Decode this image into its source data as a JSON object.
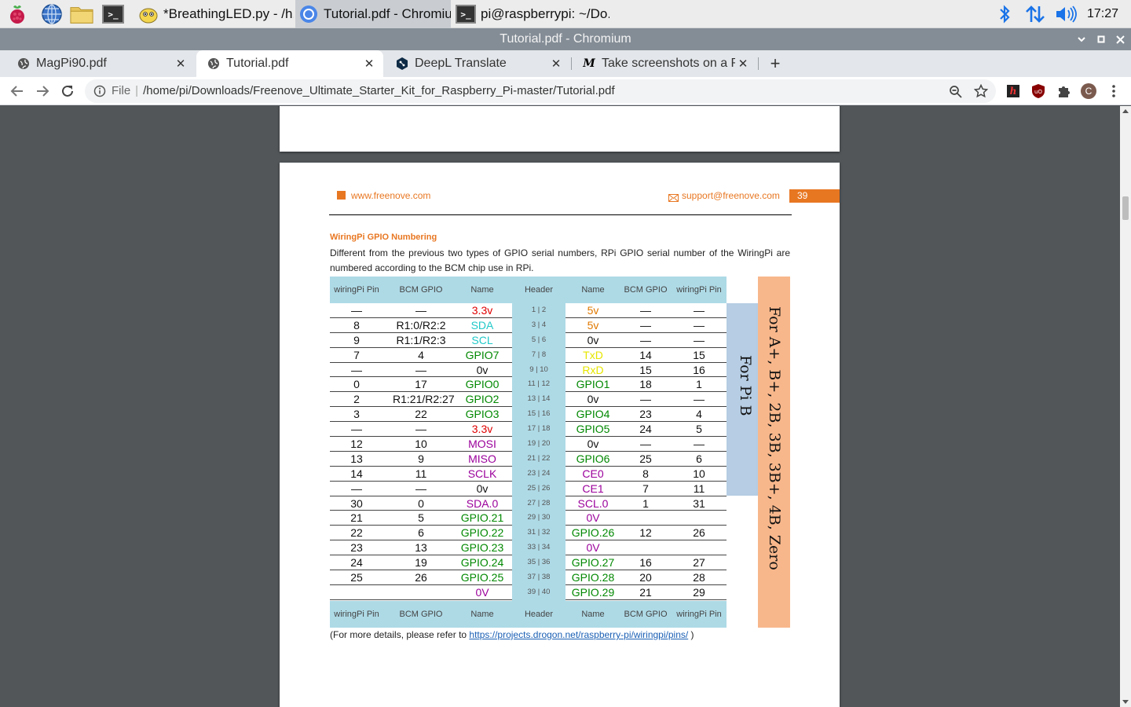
{
  "taskbar": {
    "tasks": [
      {
        "label": "*BreathingLED.py - /h...",
        "icon": "python-icon"
      },
      {
        "label": "Tutorial.pdf - Chromiu...",
        "icon": "chromium-icon"
      },
      {
        "label": "pi@raspberrypi: ~/Do...",
        "icon": "terminal-icon"
      }
    ],
    "clock": "17:27"
  },
  "window": {
    "title": "Tutorial.pdf - Chromium"
  },
  "tabs": [
    {
      "label": "MagPi90.pdf",
      "icon": "globe-icon"
    },
    {
      "label": "Tutorial.pdf",
      "icon": "globe-icon"
    },
    {
      "label": "DeepL Translate",
      "icon": "deepl-icon"
    },
    {
      "label": "Take screenshots on a R",
      "icon": "medium-icon"
    }
  ],
  "toolbar": {
    "scheme": "File",
    "url": "/home/pi/Downloads/Freenove_Ultimate_Starter_Kit_for_Raspberry_Pi-master/Tutorial.pdf",
    "avatar_letter": "C"
  },
  "pdf": {
    "header": {
      "left": "www.freenove.com",
      "right": "support@freenove.com",
      "page_number": "39"
    },
    "section_title": "WiringPi GPIO Numbering",
    "paragraph": "Different from the previous two types of GPIO serial numbers, RPi GPIO serial number of the WiringPi are numbered according to the BCM chip use in RPi.",
    "ref_prefix": "(For more details, please refer to ",
    "ref_link": "https://projects.drogon.net/raspberry-pi/wiringpi/pins/",
    "ref_suffix": " )",
    "table": {
      "head": [
        "wiringPi Pin",
        "BCM GPIO",
        "Name",
        "Header",
        "Name",
        "BCM GPIO",
        "wiringPi Pin"
      ],
      "rows": [
        [
          "—",
          "—",
          "3.3v",
          "1 | 2",
          "5v",
          "—",
          "—"
        ],
        [
          "8",
          "R1:0/R2:2",
          "SDA",
          "3 | 4",
          "5v",
          "—",
          "—"
        ],
        [
          "9",
          "R1:1/R2:3",
          "SCL",
          "5 | 6",
          "0v",
          "—",
          "—"
        ],
        [
          "7",
          "4",
          "GPIO7",
          "7 | 8",
          "TxD",
          "14",
          "15"
        ],
        [
          "—",
          "—",
          "0v",
          "9 | 10",
          "RxD",
          "15",
          "16"
        ],
        [
          "0",
          "17",
          "GPIO0",
          "11 | 12",
          "GPIO1",
          "18",
          "1"
        ],
        [
          "2",
          "R1:21/R2:27",
          "GPIO2",
          "13 | 14",
          "0v",
          "—",
          "—"
        ],
        [
          "3",
          "22",
          "GPIO3",
          "15 | 16",
          "GPIO4",
          "23",
          "4"
        ],
        [
          "—",
          "—",
          "3.3v",
          "17 | 18",
          "GPIO5",
          "24",
          "5"
        ],
        [
          "12",
          "10",
          "MOSI",
          "19 | 20",
          "0v",
          "—",
          "—"
        ],
        [
          "13",
          "9",
          "MISO",
          "21 | 22",
          "GPIO6",
          "25",
          "6"
        ],
        [
          "14",
          "11",
          "SCLK",
          "23 | 24",
          "CE0",
          "8",
          "10"
        ],
        [
          "—",
          "—",
          "0v",
          "25 | 26",
          "CE1",
          "7",
          "11"
        ],
        [
          "30",
          "0",
          "SDA.0",
          "27 | 28",
          "SCL.0",
          "1",
          "31"
        ],
        [
          "21",
          "5",
          "GPIO.21",
          "29 | 30",
          "0V",
          "",
          ""
        ],
        [
          "22",
          "6",
          "GPIO.22",
          "31 | 32",
          "GPIO.26",
          "12",
          "26"
        ],
        [
          "23",
          "13",
          "GPIO.23",
          "33 | 34",
          "0V",
          "",
          ""
        ],
        [
          "24",
          "19",
          "GPIO.24",
          "35 | 36",
          "GPIO.27",
          "16",
          "27"
        ],
        [
          "25",
          "26",
          "GPIO.25",
          "37 | 38",
          "GPIO.28",
          "20",
          "28"
        ],
        [
          "",
          "",
          "0V",
          "39 | 40",
          "GPIO.29",
          "21",
          "29"
        ]
      ],
      "name_colors_left": [
        "#e00000",
        "#22c8c8",
        "#22c8c8",
        "#008800",
        "#111111",
        "#008800",
        "#008800",
        "#008800",
        "#e00000",
        "#9b009b",
        "#9b009b",
        "#9b009b",
        "#111111",
        "#9b009b",
        "#008800",
        "#008800",
        "#008800",
        "#008800",
        "#008800",
        "#9b009b"
      ],
      "name_colors_right": [
        "#e07800",
        "#e07800",
        "#111111",
        "#e6e600",
        "#e6e600",
        "#008800",
        "#111111",
        "#008800",
        "#008800",
        "#111111",
        "#008800",
        "#9b009b",
        "#9b009b",
        "#9b009b",
        "#9b009b",
        "#008800",
        "#9b009b",
        "#008800",
        "#008800",
        "#008800"
      ],
      "side_label_pi_b": "For Pi B",
      "side_label_all": "For A+, B+, 2B, 3B, 3B+, 4B, Zero"
    }
  }
}
